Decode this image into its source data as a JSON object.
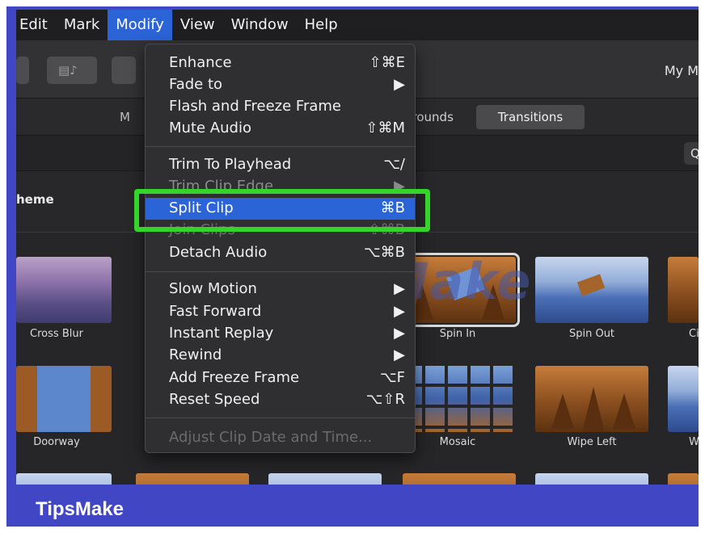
{
  "menubar": {
    "items": [
      "Edit",
      "Mark",
      "Modify",
      "View",
      "Window",
      "Help"
    ]
  },
  "toolbar": {
    "project_name": "My M"
  },
  "browser": {
    "tab_partial": "M",
    "tab_backgrounds": "grounds",
    "tab_transitions": "Transitions",
    "search_glyph": "Q",
    "theme_label": "heme"
  },
  "modify_menu": {
    "items": [
      {
        "label": "Enhance",
        "shortcut": "⇧⌘E"
      },
      {
        "label": "Fade to",
        "shortcut": "▶"
      },
      {
        "label": "Flash and Freeze Frame",
        "shortcut": ""
      },
      {
        "label": "Mute Audio",
        "shortcut": "⇧⌘M"
      },
      {
        "label": "Trim To Playhead",
        "shortcut": "⌥/"
      },
      {
        "label": "Trim Clip Edge",
        "shortcut": "▶"
      },
      {
        "label": "Split Clip",
        "shortcut": "⌘B"
      },
      {
        "label": "Join Clips",
        "shortcut": "⇧⌘B"
      },
      {
        "label": "Detach Audio",
        "shortcut": "⌥⌘B"
      },
      {
        "label": "Slow Motion",
        "shortcut": "▶"
      },
      {
        "label": "Fast Forward",
        "shortcut": "▶"
      },
      {
        "label": "Instant Replay",
        "shortcut": "▶"
      },
      {
        "label": "Rewind",
        "shortcut": "▶"
      },
      {
        "label": "Add Freeze Frame",
        "shortcut": "⌥F"
      },
      {
        "label": "Reset Speed",
        "shortcut": "⌥⇧R"
      },
      {
        "label": "Adjust Clip Date and Time...",
        "shortcut": ""
      }
    ]
  },
  "transitions": {
    "row1": [
      "Cross Blur",
      "Spin In",
      "Spin Out",
      "Ci"
    ],
    "row2": [
      "Doorway",
      "Mosaic",
      "Wipe Left",
      "W"
    ]
  },
  "watermark": "TipsMake",
  "brand": "TipsMake",
  "colors": {
    "frame": "#4146c4",
    "menu_highlight": "#2b64d6",
    "callout_box": "#35d42a"
  }
}
